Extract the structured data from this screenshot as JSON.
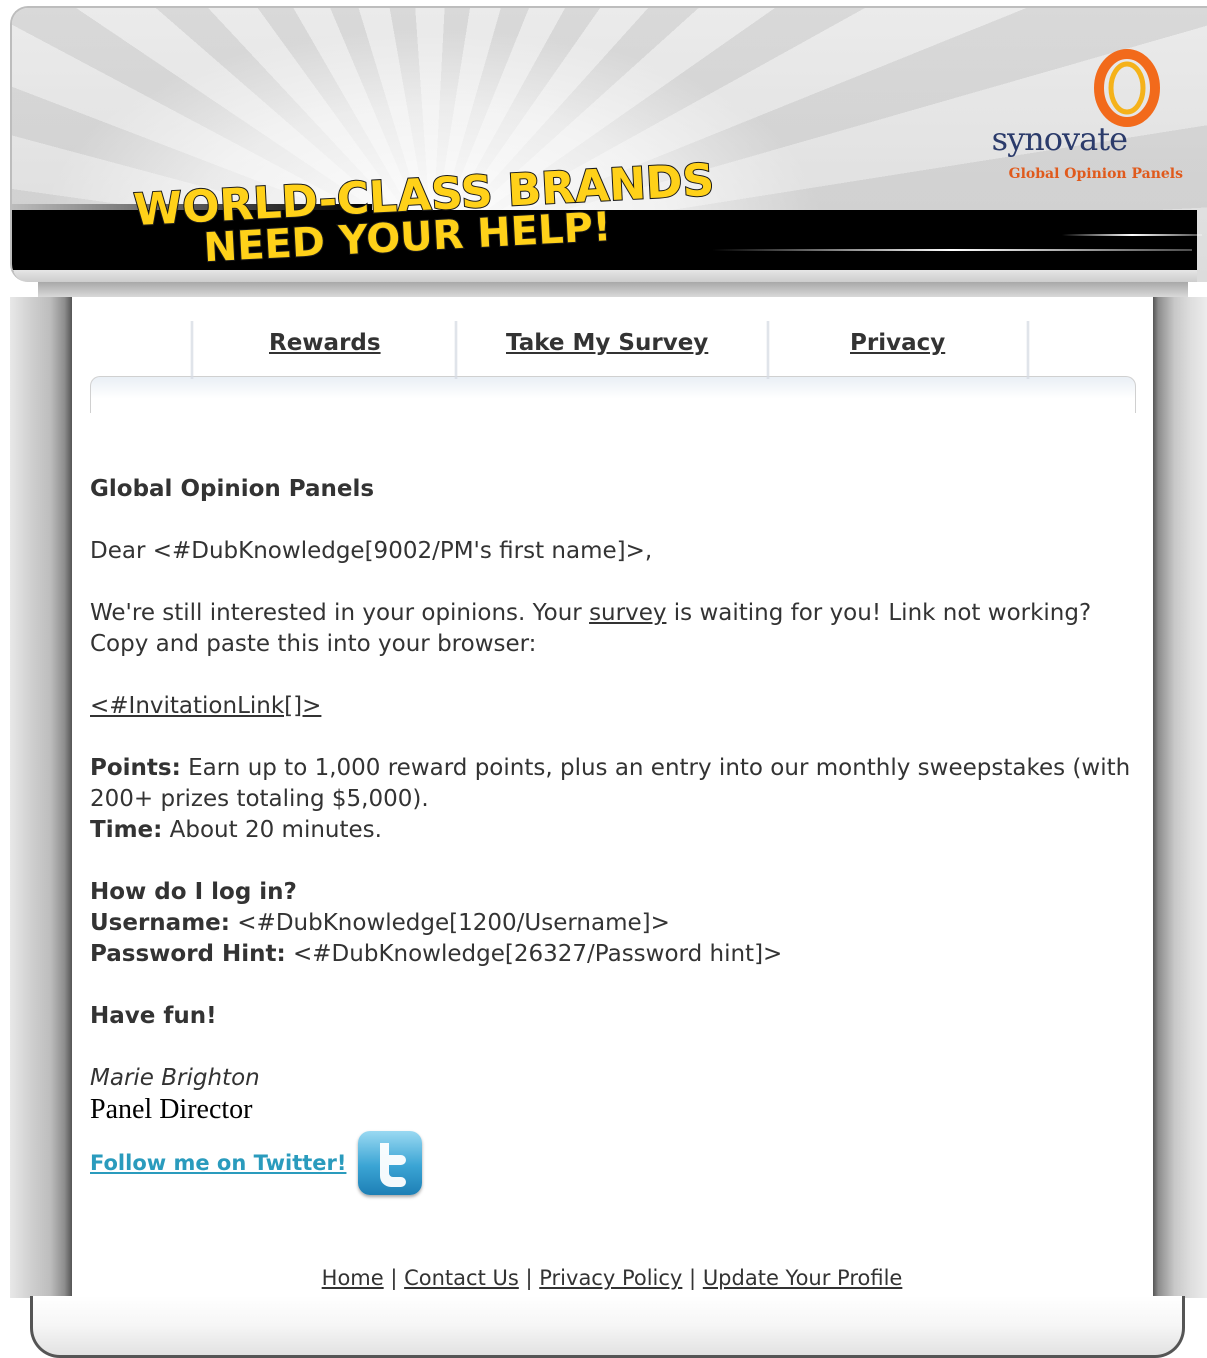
{
  "header": {
    "headline_line1": "WORLD-CLASS BRANDS",
    "headline_line2": "NEED YOUR HELP!",
    "logo_word": "synovate",
    "logo_subtitle": "Global Opinion Panels",
    "colors": {
      "headline_fill": "#ffd119",
      "logo_ring_outer": "#f26a1b",
      "logo_ring_inner": "#f5b21a",
      "logo_text": "#2b3b6b"
    }
  },
  "nav": {
    "items": [
      {
        "label": "Rewards"
      },
      {
        "label": "Take My Survey"
      },
      {
        "label": "Privacy"
      }
    ]
  },
  "body": {
    "heading": "Global Opinion Panels",
    "greeting": "Dear <#DubKnowledge[9002/PM's first name]>,",
    "para_before": "We're still interested in your opinions. Your ",
    "survey_link": "survey",
    "para_after": " is waiting for you! Link not working? Copy and paste this into your browser:",
    "invitation_link": "<#InvitationLink[]>",
    "points_label": "Points:",
    "points_text": " Earn up to 1,000 reward points, plus an entry into our monthly sweepstakes (with 200+ prizes totaling $5,000).",
    "time_label": "Time:",
    "time_text": " About 20 minutes.",
    "login_heading": "How do I log in?",
    "username_label": "Username:",
    "username_value": " <#DubKnowledge[1200/Username]>",
    "password_label": "Password Hint:",
    "password_value": " <#DubKnowledge[26327/Password hint]>",
    "closing": "Have fun!",
    "signature_name": "Marie Brighton",
    "signature_title": "Panel Director",
    "twitter_link": "Follow me on Twitter! ",
    "twitter_icon": "twitter-bird-icon"
  },
  "footer": {
    "links": [
      "Home",
      "Contact Us",
      "Privacy Policy",
      "Update Your Profile"
    ],
    "separator": " | "
  }
}
